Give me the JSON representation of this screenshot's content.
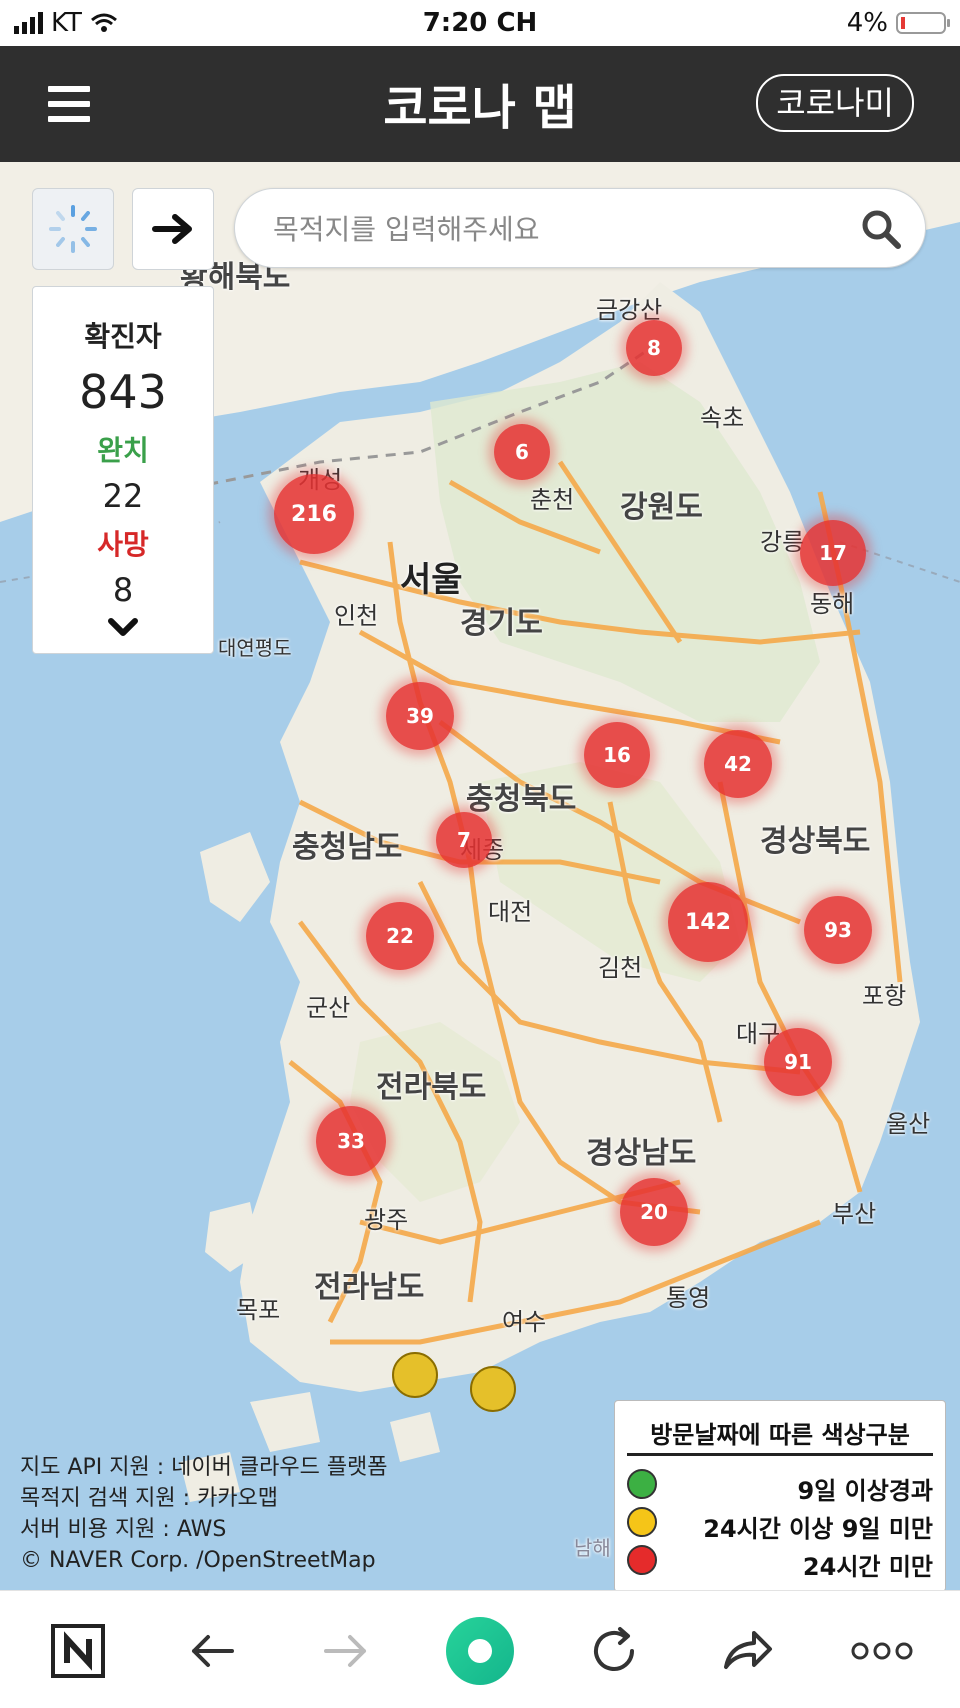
{
  "status_bar": {
    "carrier": "KT",
    "time": "7:20 CH",
    "battery": "4%"
  },
  "app_bar": {
    "title": "코로나 맵",
    "button_label": "코로나미"
  },
  "search": {
    "placeholder": "목적지를 입력해주세요"
  },
  "stats": {
    "confirmed_label": "확진자",
    "confirmed": "843",
    "recovered_label": "완치",
    "recovered": "22",
    "deaths_label": "사망",
    "deaths": "8"
  },
  "clusters": [
    {
      "id": "cluster-8-sokcho",
      "value": "8",
      "color": "red"
    },
    {
      "id": "cluster-6-cheorwon",
      "value": "6",
      "color": "red"
    },
    {
      "id": "cluster-216-gyeonggi",
      "value": "216",
      "color": "red"
    },
    {
      "id": "cluster-17-donghae",
      "value": "17",
      "color": "red"
    },
    {
      "id": "cluster-39-chungnam",
      "value": "39",
      "color": "red"
    },
    {
      "id": "cluster-16-chungbuk",
      "value": "16",
      "color": "red"
    },
    {
      "id": "cluster-42-gyeongbuk",
      "value": "42",
      "color": "red"
    },
    {
      "id": "cluster-7-daejeon",
      "value": "7",
      "color": "red"
    },
    {
      "id": "cluster-142-daegu",
      "value": "142",
      "color": "red"
    },
    {
      "id": "cluster-93-pohang",
      "value": "93",
      "color": "red"
    },
    {
      "id": "cluster-22-jeonbuk",
      "value": "22",
      "color": "red"
    },
    {
      "id": "cluster-91-ulsan",
      "value": "91",
      "color": "red"
    },
    {
      "id": "cluster-33-gwangju",
      "value": "33",
      "color": "red"
    },
    {
      "id": "cluster-20-tongyeong",
      "value": "20",
      "color": "red"
    }
  ],
  "map_labels": {
    "hwanghae": "황해북도",
    "geumgangsan": "금강산",
    "sokcho": "속초",
    "gaeseong": "개성",
    "gangwon": "강원도",
    "gangneung": "강릉",
    "seoul": "서울",
    "incheon": "인천",
    "gyeonggi": "경기도",
    "yeonpyeong": "대연평도",
    "chungbuk": "충청북도",
    "chungnam": "충청남도",
    "sejong": "세종",
    "gyeongbuk": "경상북도",
    "daejeon": "대전",
    "gimcheon": "김천",
    "gunsan": "군산",
    "pohang": "포항",
    "daegu": "대구",
    "jeonbuk": "전라북도",
    "ulsan": "울산",
    "gyeongnam": "경상남도",
    "busan": "부산",
    "gwangju": "광주",
    "tongyeong": "통영",
    "jeonnam": "전라남도",
    "mokpo": "목포",
    "yeosu": "여수",
    "chuncheon": "춘천",
    "donghae": "동해",
    "namhae": "남해"
  },
  "credits": {
    "line1": "지도 API 지원 : 네이버 클라우드 플랫폼",
    "line2": "목적지 검색 지원 : 카카오맵",
    "line3": "서버 비용 지원 : AWS",
    "line4": "© NAVER Corp. /OpenStreetMap"
  },
  "legend": {
    "title": "방문날짜에 따른 색상구분",
    "items": [
      {
        "label": "9일 이상경과",
        "color": "#3cb043"
      },
      {
        "label": "24시간 이상 9일 미만",
        "color": "#f5c518"
      },
      {
        "label": "24시간 미만",
        "color": "#e52b2b"
      }
    ]
  },
  "colors": {
    "appbar": "#2f2f2f",
    "water": "#a7cde9",
    "land": "#f2efe6",
    "road": "#f5a94a",
    "cluster_red": "#e53232"
  }
}
